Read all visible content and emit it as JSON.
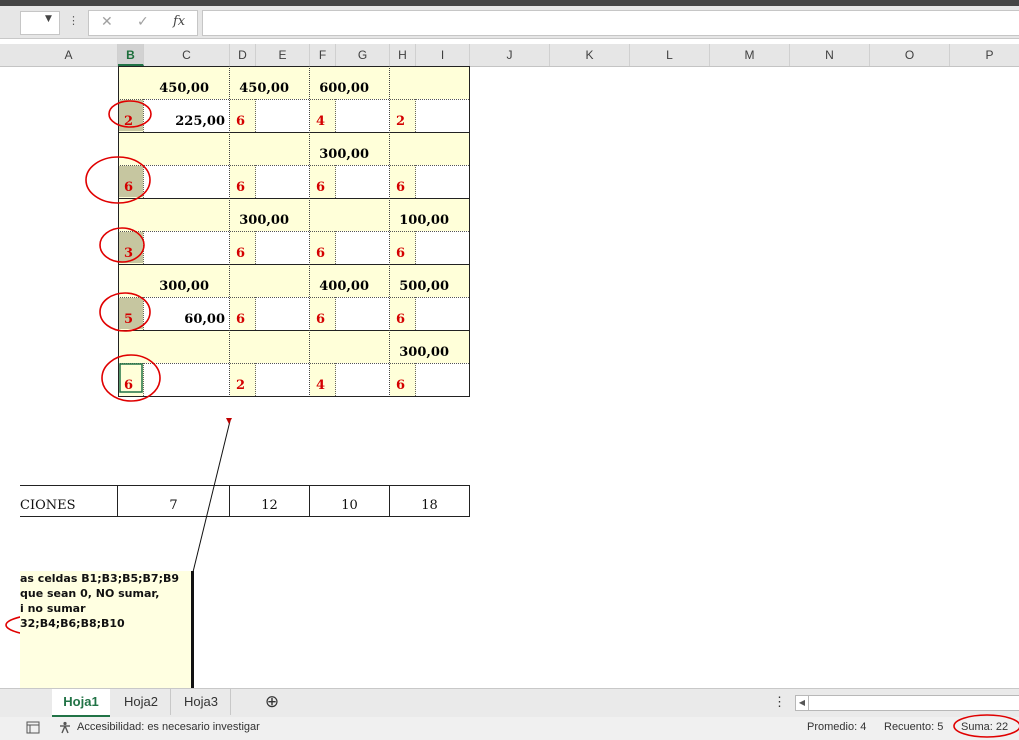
{
  "formula_bar": {
    "cancel": "✕",
    "confirm": "✓",
    "fx": "fx",
    "dots": "⋮",
    "namebox_dropdown": "▼"
  },
  "columns": [
    "A",
    "B",
    "C",
    "D",
    "E",
    "F",
    "G",
    "H",
    "I",
    "J",
    "K",
    "L",
    "M",
    "N",
    "O",
    "P"
  ],
  "selected_column": "B",
  "grid": [
    {
      "top": [
        "",
        "450,00",
        "450,00",
        "600,00",
        ""
      ],
      "bottom": {
        "B": "2",
        "C": "225,00",
        "D": "6",
        "F": "4",
        "H": "2"
      }
    },
    {
      "top": [
        "",
        "",
        "",
        "300,00",
        ""
      ],
      "bottom": {
        "B": "6",
        "C": "",
        "D": "6",
        "F": "6",
        "H": "6"
      }
    },
    {
      "top": [
        "",
        "",
        "300,00",
        "",
        "100,00"
      ],
      "bottom": {
        "B": "3",
        "C": "",
        "D": "6",
        "F": "6",
        "H": "6"
      }
    },
    {
      "top": [
        "",
        "300,00",
        "",
        "400,00",
        "500,00"
      ],
      "bottom": {
        "B": "5",
        "C": "60,00",
        "D": "6",
        "F": "6",
        "H": "6"
      }
    },
    {
      "top": [
        "",
        "",
        "",
        "",
        "300,00"
      ],
      "bottom": {
        "B": "6",
        "C": "",
        "D": "2",
        "F": "4",
        "H": "6"
      }
    }
  ],
  "summary_row": {
    "label": "CIONES",
    "b": "7",
    "d": "12",
    "f": "10",
    "h": "18"
  },
  "comment_lines": [
    "as celdas B1;B3;B5;B7;B9",
    "que sean 0, NO sumar,",
    "i no sumar",
    "32;B4;B6;B8;B10"
  ],
  "sheet_tabs": [
    {
      "label": "Hoja1",
      "active": true
    },
    {
      "label": "Hoja2",
      "active": false
    },
    {
      "label": "Hoja3",
      "active": false
    }
  ],
  "add_sheet_icon": "⊕",
  "status": {
    "accessibility": "Accesibilidad: es necesario investigar",
    "promedio": "Promedio: 4",
    "recuento": "Recuento: 5",
    "suma": "Suma: 22"
  },
  "colors": {
    "accent": "#217346",
    "annotation_red": "#d40000",
    "yellow_fill": "#ffffd9"
  }
}
